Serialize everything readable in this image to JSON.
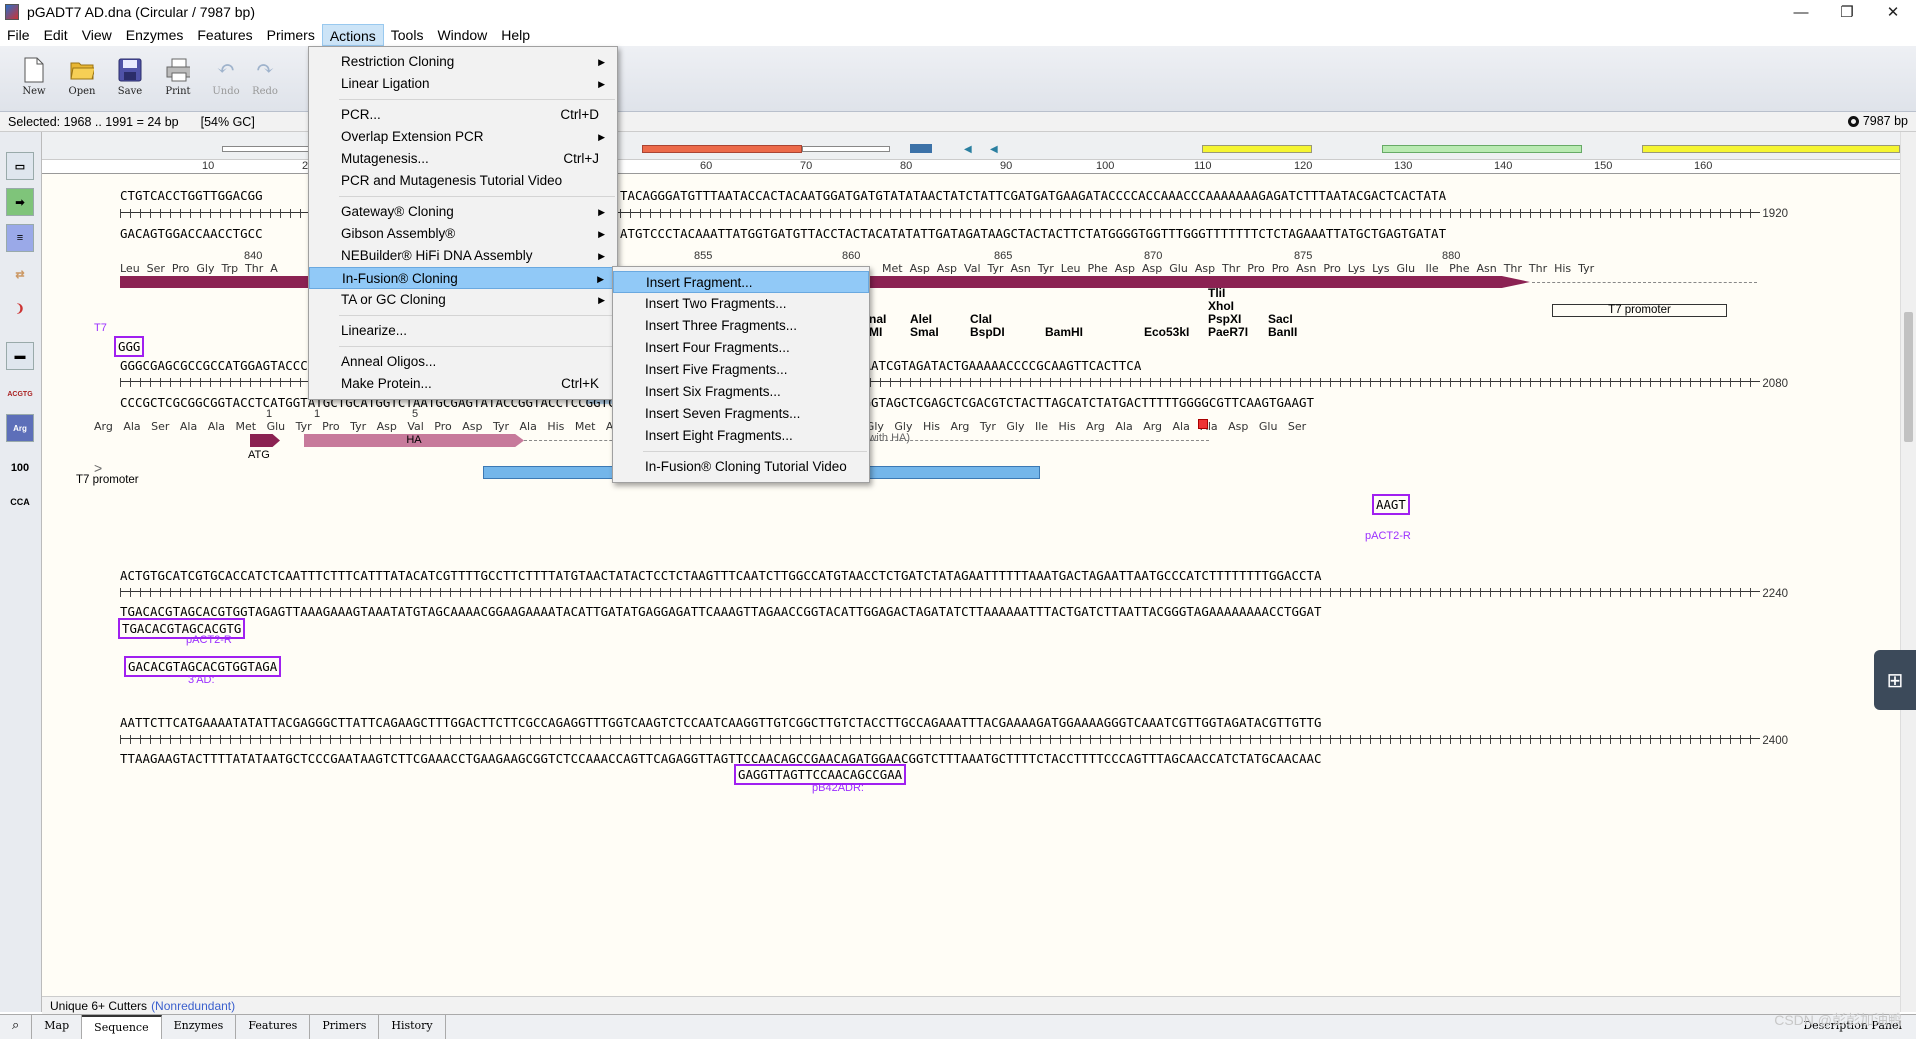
{
  "window": {
    "title": "pGADT7 AD.dna  (Circular / 7987 bp)",
    "min": "—",
    "max": "❐",
    "close": "✕"
  },
  "menu": [
    "File",
    "Edit",
    "View",
    "Enzymes",
    "Features",
    "Primers",
    "Actions",
    "Tools",
    "Window",
    "Help"
  ],
  "toolbar": [
    {
      "label": "New",
      "icon": "new-file-icon"
    },
    {
      "label": "Open",
      "icon": "open-folder-icon"
    },
    {
      "label": "Save",
      "icon": "save-disk-icon"
    },
    {
      "label": "Print",
      "icon": "printer-icon"
    },
    {
      "label": "Undo",
      "icon": "undo-icon"
    },
    {
      "label": "Redo",
      "icon": "redo-icon"
    }
  ],
  "selection": {
    "text": "Selected:  1968 .. 1991  =  24 bp",
    "gc": "[54% GC]",
    "total": "7987 bp"
  },
  "ruler": [
    "10",
    "20",
    "60",
    "70",
    "80",
    "90",
    "100",
    "110",
    "120",
    "130",
    "140",
    "150",
    "160"
  ],
  "rows": [
    {
      "top": "CTGTCACCTGGTTGGACGG",
      "top2": "TACAGGGATGTTTAATACCACTACAATGGATGATGTATATAACTATCTATTCGATGATGAAGATACCCCACCAAACCCAAAAAAAGAGATCTTTAATACGACTCACTATA",
      "bot": "GACAGTGGACCAACCTGCC",
      "bot2": "ATGTCCCTACAAATTATGGTGATGTTACCTACTACATATATTGATAGATAAGCTACTACTTCTATGGGGTGGTTTGGGTTTTTTTCTCTAGAAATTATGCTGAGTGATAT",
      "num": "1920"
    },
    {
      "top": "GGGCGAGCGCCGCCATGGAGTACCCATACGACGTACCAGATTACGCTCATATGGCCATGGAGGCCCCGGGGATCCGAATTCGAGCTCGAGCTGCAGATGAATCGTAGATACTGAAAAACCCCGCAAGTTCACTTCA",
      "bot": "CCCGCTCGCGGCGGTACCTCATGGTATGCTGCATGGTCTAATGCGAGTATACCGGTACCTCCGGTCACTTAAGGTGGGCCCACCCGTAGCTATGCCCTAGGTAGCTCGAGCTCGACGTCTACTTAGCATCTATGACTTTTTGGGGCGTTCAAGTGAAGT",
      "num": "2080"
    },
    {
      "top": "ACTGTGCATCGTGCACCATCTCAATTTCTTTCATTTATACATCGTTTTGCCTTCTTTTATGTAACTATACTCCTCTAAGTTTCAATCTTGGCCATGTAACCTCTGATCTATAGAATTTTTTAAATGACTAGAATTAATGCCCATCTTTTTTTTGGACCTA",
      "bot": "TGACACGTAGCACGTGGTAGAGTTAAAGAAAGTAAATATGTAGCAAAACGGAAGAAAATACATTGATATGAGGAGATTCAAAGTTAGAACCGGTACATTGGAGACTAGATATCTTAAAAAATTTACTGATCTTAATTACGGGTAGAAAAAAAACCTGGAT",
      "num": "2240"
    },
    {
      "top": "AATTCTTCATGAAAATATATTACGAGGGCTTATTCAGAAGCTTTGGACTTCTTCGCCAGAGGTTTGGTCAAGTCTCCAATCAAGGTTGTCGGCTTGTCTACCTTGCCAGAAATTTACGAAAAGATGGAAAAGGGTCAAATCGTTGGTAGATACGTTGTTG",
      "bot": "TTAAGAAGTACTTTTATATAATGCTCCCGAATAAGTCTTCGAAACCTGAAGAAGCGGTCTCCAAACCAGTTCAGAGGTTAGTTCCAACAGCCGAACAGATGGAACGGTCTTTAAATGCTTTTCTACCTTTTCCCAGTTTAGCAACCATCTATGCAACAAC",
      "num": "2400"
    }
  ],
  "aa1": "Leu  Ser  Pro  Gly  Trp  Thr  A",
  "aa1b": "Met  Asp  Asp  Val  Tyr  Asn  Tyr  Leu  Phe  Asp  Asp  Glu  Asp  Thr  Pro  Pro  Asn  Pro  Lys  Lys  Glu   Ile   Phe  Asn  Thr  Thr  His  Tyr",
  "aa1nums": [
    "840",
    "855",
    "860",
    "865",
    "870",
    "875",
    "880"
  ],
  "aa2": "Arg   Ala   Ser   Ala   Ala   Met   Glu   Tyr   Pro   Tyr   Asp   Val   Pro   Asp   Tyr   Ala   His   Met   Ala   Met   Glu   Ala   Ser   Glu   Phe   His   Pro   Gly   Gly   His   Arg   Tyr   Gly   Ile   His   Arg   Ala   Arg   Ala   Ala   Asp   Glu   Ser",
  "aa2nums": [
    "1",
    "1",
    "5"
  ],
  "features": {
    "t7promoter": "T7 promoter",
    "atg": "ATG",
    "ha": "HA",
    "mcs": "MCS",
    "inframe": "(in frame with HA)",
    "t7": "T7",
    "ggg": "GGG",
    "pact2r": "pACT2-R",
    "aagt": "AAGT",
    "pact2r_box": "TGACACGTAGCACGTG",
    "ad3_box": "GACACGTAGCACGTGGTAGA",
    "ad3": "3'AD:",
    "pb42_box": "GAGGTTAGTTCCAACAGCCGAA",
    "pb42": "pB42ADR:"
  },
  "enzymes": [
    {
      "name": "naI\nMI"
    },
    {
      "name": "AleI\nSmaI"
    },
    {
      "name": "ClaI\nBspDI"
    },
    {
      "name": "BamHI"
    },
    {
      "name": "Eco53kI"
    },
    {
      "name": "TliI\nXhoI\nPspXI\nPaeR7I"
    },
    {
      "name": "SacI\nBanII"
    }
  ],
  "actions_menu": [
    {
      "label": "Restriction Cloning",
      "arrow": "▶"
    },
    {
      "label": "Linear Ligation",
      "arrow": "▶"
    },
    {
      "sep": true
    },
    {
      "label": "PCR...",
      "sc": "Ctrl+D"
    },
    {
      "label": "Overlap Extension PCR",
      "arrow": "▶"
    },
    {
      "label": "Mutagenesis...",
      "sc": "Ctrl+J"
    },
    {
      "label": "PCR and Mutagenesis Tutorial Video"
    },
    {
      "sep": true
    },
    {
      "label": "Gateway® Cloning",
      "arrow": "▶"
    },
    {
      "label": "Gibson Assembly®",
      "arrow": "▶"
    },
    {
      "label": "NEBuilder® HiFi DNA Assembly",
      "arrow": "▶"
    },
    {
      "label": "In-Fusion® Cloning",
      "arrow": "▶",
      "hl": true
    },
    {
      "label": "TA or GC Cloning",
      "arrow": "▶"
    },
    {
      "sep": true
    },
    {
      "label": "Linearize..."
    },
    {
      "sep": true
    },
    {
      "label": "Anneal Oligos..."
    },
    {
      "label": "Make Protein...",
      "sc": "Ctrl+K"
    }
  ],
  "infusion_menu": [
    {
      "label": "Insert Fragment...",
      "hl": true
    },
    {
      "label": "Insert Two Fragments..."
    },
    {
      "label": "Insert Three Fragments..."
    },
    {
      "label": "Insert Four Fragments..."
    },
    {
      "label": "Insert Five Fragments..."
    },
    {
      "label": "Insert Six Fragments..."
    },
    {
      "label": "Insert Seven Fragments..."
    },
    {
      "label": "Insert Eight Fragments..."
    },
    {
      "sep": true
    },
    {
      "label": "In-Fusion® Cloning Tutorial Video"
    }
  ],
  "status": {
    "cutters": "Unique 6+ Cutters",
    "nonredundant": "(Nonredundant)"
  },
  "tabs": [
    "Map",
    "Sequence",
    "Enzymes",
    "Features",
    "Primers",
    "History"
  ],
  "active_tab": "Sequence",
  "desc_panel": "Description Panel",
  "watermark": "CSDN @彭彭加油鸭",
  "colors": {
    "feature_maroon": "#8b2252",
    "ha_pink": "#c77a9b",
    "mcs_blue": "#74b6ea",
    "primer_purple": "#a020f0",
    "selection": "#9cc8f0"
  }
}
